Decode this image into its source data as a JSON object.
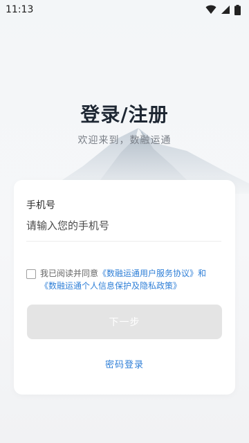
{
  "status_bar": {
    "time": "11:13",
    "icons": [
      "wifi-icon",
      "signal-icon",
      "battery-icon"
    ]
  },
  "header": {
    "title": "登录/注册",
    "subtitle": "欢迎来到，数融运通"
  },
  "form": {
    "phone_label": "手机号",
    "phone_placeholder": "请输入您的手机号",
    "phone_value": "",
    "agreement": {
      "prefix": "我已阅读并同意",
      "user_agreement": "《数融运通用户服务协议》",
      "and": "和",
      "privacy_policy": "《数融运通个人信息保护及隐私政策》",
      "checked": false
    },
    "next_button": "下一步",
    "password_login": "密码登录"
  },
  "colors": {
    "link": "#2f7fd7",
    "title": "#1e2733",
    "button_disabled": "#e4e4e4"
  }
}
